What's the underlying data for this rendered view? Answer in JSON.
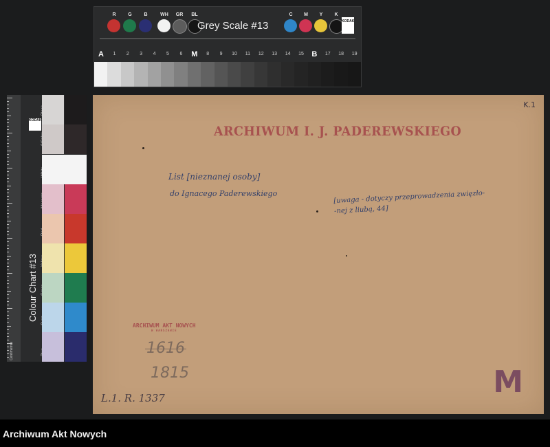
{
  "grey_scale_target": {
    "title": "Grey Scale #13",
    "logo_text": "KODAK",
    "patches": [
      {
        "label": "R",
        "color": "#c43331"
      },
      {
        "label": "G",
        "color": "#1f7a4b"
      },
      {
        "label": "B",
        "color": "#2a2f73"
      },
      {
        "label": "WH",
        "color": "#f2f2f2"
      },
      {
        "label": "GR",
        "color": "#5c5c5c"
      },
      {
        "label": "BL",
        "color": "#151515"
      },
      {
        "label": "C",
        "color": "#2f86c8"
      },
      {
        "label": "M",
        "color": "#cf3453"
      },
      {
        "label": "Y",
        "color": "#e7c53a"
      },
      {
        "label": "K",
        "color": "#141414"
      }
    ],
    "steps": [
      "A",
      "1",
      "2",
      "3",
      "4",
      "5",
      "6",
      "M",
      "8",
      "9",
      "10",
      "11",
      "12",
      "13",
      "14",
      "15",
      "B",
      "17",
      "18",
      "19"
    ],
    "step_colors": [
      "#f2f2f2",
      "#dcdcdc",
      "#c8c8c8",
      "#b4b4b4",
      "#a2a2a2",
      "#909090",
      "#808080",
      "#707070",
      "#626262",
      "#555555",
      "#4a4a4a",
      "#404040",
      "#373737",
      "#2f2f2f",
      "#292929",
      "#242424",
      "#202020",
      "#1c1c1c",
      "#191919",
      "#171717"
    ]
  },
  "colour_chart": {
    "title": "Colour Chart #13",
    "logo_text": "KODAK",
    "labels": [
      "Black",
      "3/Color",
      "White",
      "Magenta",
      "Red",
      "Yellow",
      "Green",
      "Cyan",
      "Blue"
    ],
    "unit_label": "Centimetres",
    "swatches": [
      {
        "color": "#d7d5d4"
      },
      {
        "color": "#1d1b1c"
      },
      {
        "color": "#cfc9c8"
      },
      {
        "color": "#2e2829"
      },
      {
        "color": "#f4f4f4"
      },
      {
        "color": "#e3bfcb"
      },
      {
        "color": "#c93a58"
      },
      {
        "color": "#ebc6ae"
      },
      {
        "color": "#c8382c"
      },
      {
        "color": "#efe3ad"
      },
      {
        "color": "#ecc83a"
      },
      {
        "color": "#bcd6c2"
      },
      {
        "color": "#1f7c4f"
      },
      {
        "color": "#bcd6ea"
      },
      {
        "color": "#2f8acb"
      },
      {
        "color": "#c7bfdb"
      },
      {
        "color": "#2a2c6c"
      }
    ]
  },
  "document": {
    "page_code": "K.1",
    "stamp": "ARCHIWUM I. J. PADEREWSKIEGO",
    "handwriting_line1": "List [nieznanej osoby]",
    "handwriting_line2": "do Ignacego Paderewskiego",
    "note_line1": "[uwaga - dotyczy przeprowadzenia zwięzło-",
    "note_line2": "-nej z liubą, 44]",
    "small_stamp": "ARCHIWUM AKT NOWYCH",
    "small_stamp_sub": "W WARSZAWIE",
    "old_number": "1616",
    "new_number": "1815",
    "signature": "L.1. R. 1337",
    "letter_stamp": "M"
  },
  "footer": {
    "text": "Archiwum Akt Nowych"
  }
}
